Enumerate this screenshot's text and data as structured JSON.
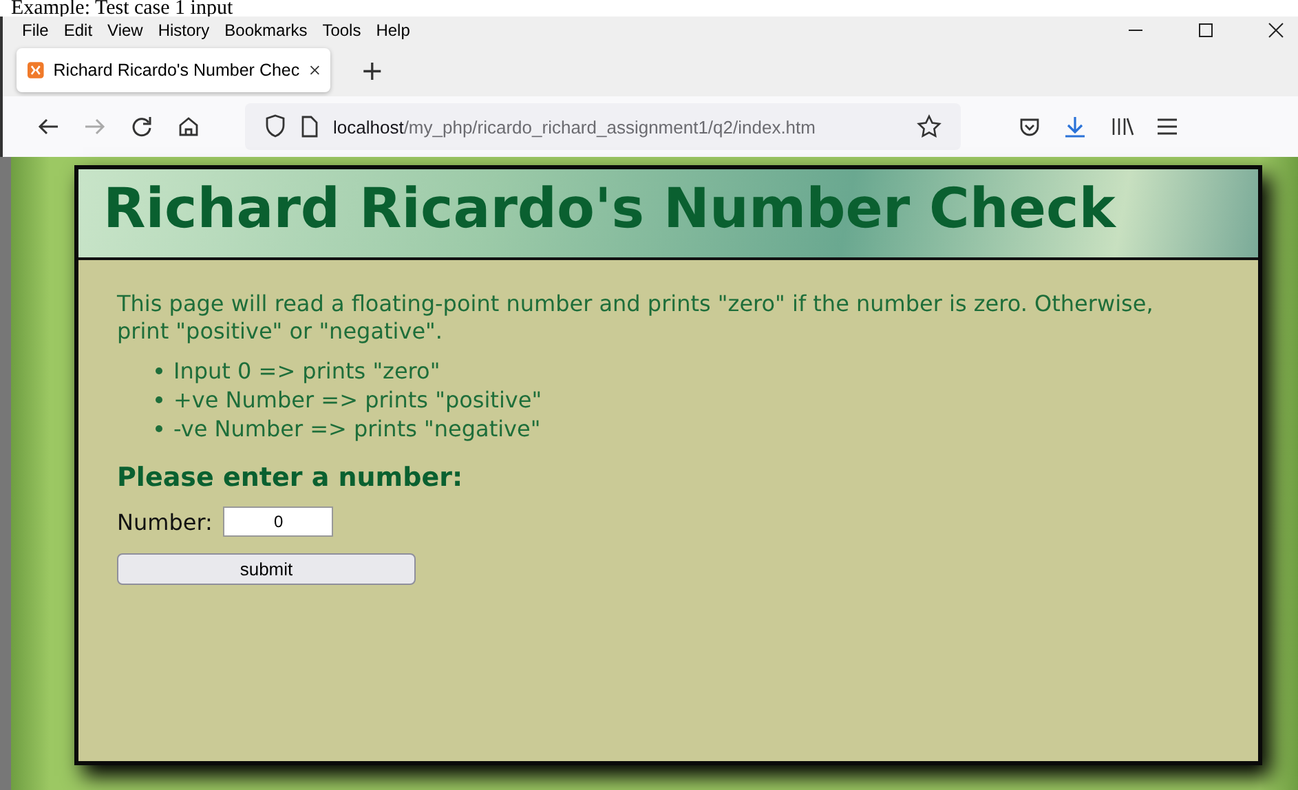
{
  "caption": "Example: Test case 1 input",
  "menu_bar": [
    "File",
    "Edit",
    "View",
    "History",
    "Bookmarks",
    "Tools",
    "Help"
  ],
  "tabs": [
    {
      "label": "Richard Ricardo's Number Chec",
      "selected": true
    }
  ],
  "new_tab": "+",
  "address_bar": {
    "host": "localhost",
    "path": "/my_php/ricardo_richard_assignment1/q2/index.htm"
  },
  "page": {
    "title": "Richard Ricardo's Number Check",
    "intro": "This page will read a floating-point number and prints \"zero\" if the number is zero. Otherwise, print \"positive\" or \"negative\".",
    "rules": [
      "Input 0 => prints \"zero\"",
      "+ve Number => prints \"positive\"",
      "-ve Number => prints \"negative\""
    ],
    "form_heading": "Please enter a number:",
    "field": {
      "label": "Number:",
      "value": "0"
    },
    "submit": "submit"
  }
}
